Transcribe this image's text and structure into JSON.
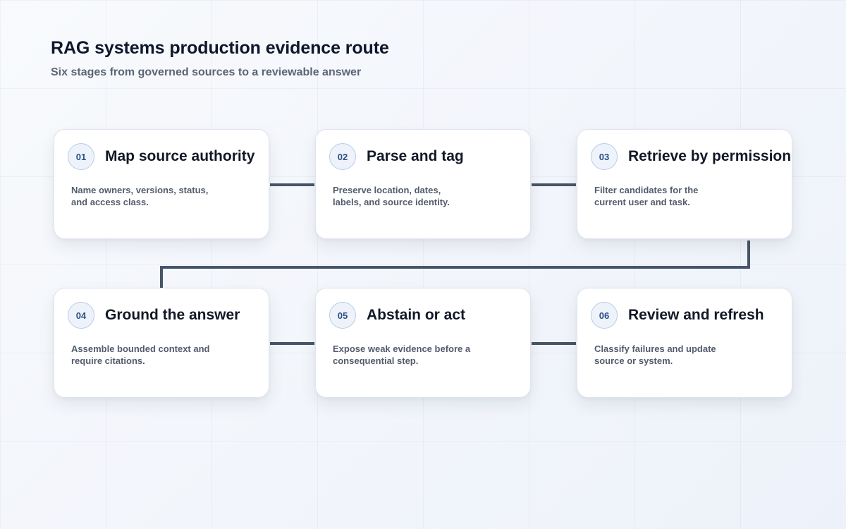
{
  "header": {
    "title": "RAG systems production evidence route",
    "subtitle": "Six stages from governed sources to a reviewable answer"
  },
  "stages": [
    {
      "number": "01",
      "title": "Map source authority",
      "desc": [
        "Name owners, versions, status,",
        "and access class."
      ]
    },
    {
      "number": "02",
      "title": "Parse and tag",
      "desc": [
        "Preserve location, dates,",
        "labels, and source identity."
      ]
    },
    {
      "number": "03",
      "title": "Retrieve by permission",
      "desc": [
        "Filter candidates for the",
        "current user and task."
      ]
    },
    {
      "number": "04",
      "title": "Ground the answer",
      "desc": [
        "Assemble bounded context and",
        "require citations."
      ]
    },
    {
      "number": "05",
      "title": "Abstain or act",
      "desc": [
        "Expose weak evidence before a",
        "consequential step."
      ]
    },
    {
      "number": "06",
      "title": "Review and refresh",
      "desc": [
        "Classify failures and update",
        "source or system."
      ]
    }
  ],
  "colors": {
    "connector": "#475569",
    "badge_text": "#2c4f86",
    "title_text": "#0f172a"
  }
}
